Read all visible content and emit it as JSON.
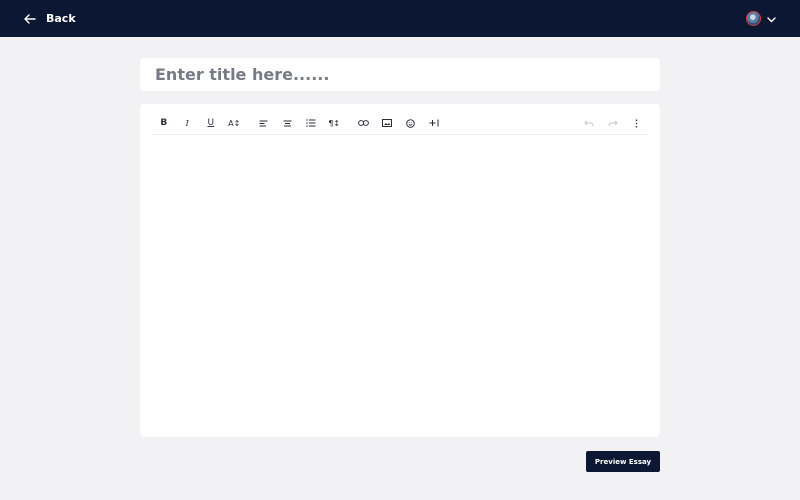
{
  "topbar": {
    "back_label": "Back",
    "back_icon": "arrow-left-icon",
    "avatar_icon": "user-avatar",
    "menu_icon": "chevron-down-icon"
  },
  "title_field": {
    "value": "",
    "placeholder": "Enter title here......"
  },
  "toolbar": {
    "bold_label": "B",
    "italic_label": "I",
    "underline_label": "U",
    "font_size_label": "A↕",
    "paragraph_label": "¶↕",
    "undo_enabled": false,
    "redo_enabled": false
  },
  "footer": {
    "preview_label": "Preview Essay"
  },
  "colors": {
    "topbar_bg": "#0c1733",
    "page_bg": "#f2f2f4",
    "button_bg": "#0c1733"
  }
}
